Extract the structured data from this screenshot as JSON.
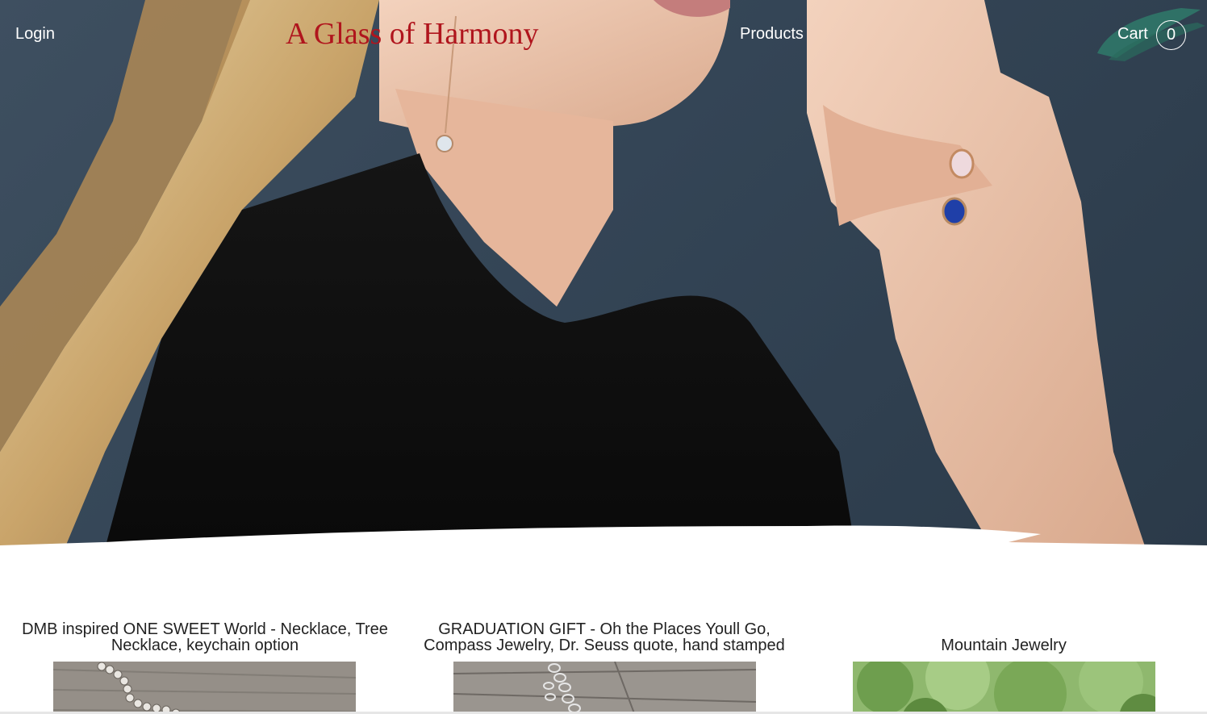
{
  "header": {
    "login_label": "Login",
    "brand_title": "A Glass of Harmony",
    "products_label": "Products",
    "cart_label": "Cart",
    "cart_count": "0"
  },
  "colors": {
    "brand": "#b0151d",
    "nav_text": "#ffffff",
    "hero_background": "#3a4b5c",
    "cart_brush": "#2f7a6a"
  },
  "hero": {
    "image": "woman-wearing-earring-and-rings"
  },
  "products": [
    {
      "title": "DMB inspired ONE SWEET World - Necklace, Tree Necklace, keychain option",
      "image": "beaded-chain-on-wood"
    },
    {
      "title": "GRADUATION GIFT - Oh the Places Youll Go, Compass Jewelry, Dr. Seuss quote, hand stamped",
      "image": "silver-chain-on-wood"
    },
    {
      "title": "Mountain Jewelry",
      "image": "green-foliage"
    }
  ]
}
